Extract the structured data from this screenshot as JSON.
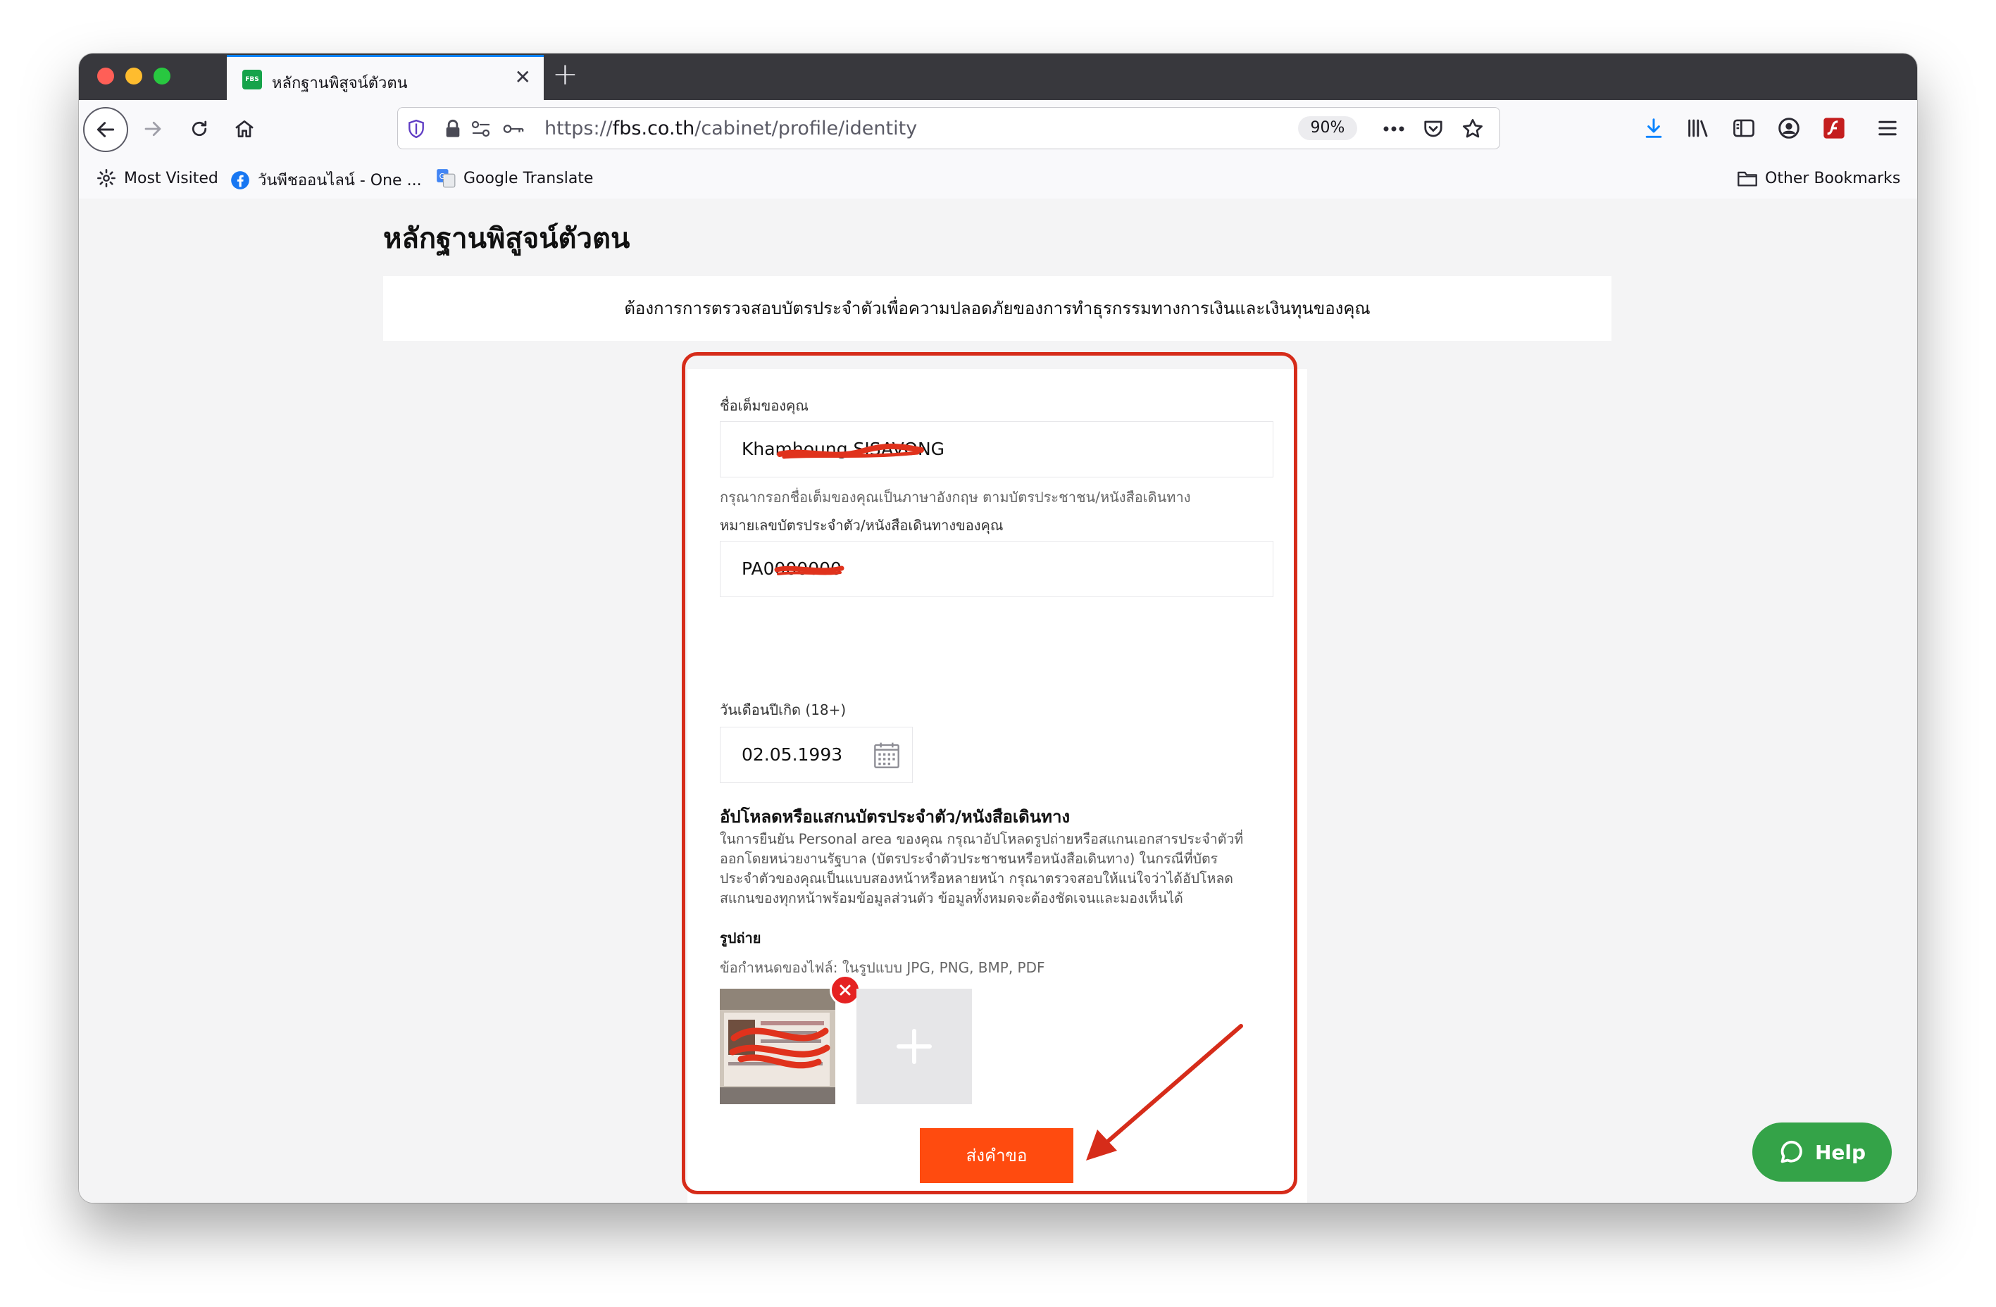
{
  "browser": {
    "tab": {
      "title": "หลักฐานพิสูจน์ตัวตน",
      "favicon_text": "FBS"
    },
    "url": {
      "scheme": "https://",
      "host": "fbs.co.th",
      "path": "/cabinet/profile/identity"
    },
    "zoom": "90%",
    "bookmarks": [
      {
        "label": "Most Visited",
        "icon": "gear-icon"
      },
      {
        "label": "วันพีชออนไลน์ - One ...",
        "icon": "facebook-icon"
      },
      {
        "label": "Google Translate",
        "icon": "google-translate-icon"
      }
    ],
    "other_bookmarks": "Other Bookmarks"
  },
  "page": {
    "title": "หลักฐานพิสูจน์ตัวตน",
    "banner": "ต้องการการตรวจสอบบัตรประจำตัวเพื่อความปลอดภัยของการทำธุรกรรมทางการเงินและเงินทุนของคุณ"
  },
  "form": {
    "fullname_label": "ชื่อเต็มของคุณ",
    "fullname_value": "Khamhoung SISAVONG",
    "fullname_hint": "กรุณากรอกชื่อเต็มของคุณเป็นภาษาอังกฤษ ตามบัตรประชาชน/หนังสือเดินทาง",
    "id_label": "หมายเลขบัตรประจำตัว/หนังสือเดินทางของคุณ",
    "id_value": "PA0000000",
    "dob_label": "วันเดือนปีเกิด (18+)",
    "dob_value": "02.05.1993",
    "upload_title": "อัปโหลดหรือแสกนบัตรประจำตัว/หนังสือเดินทาง",
    "upload_desc": [
      "ในการยืนยัน Personal area ของคุณ กรุณาอัปโหลดรูปถ่ายหรือสแกนเอกสารประจำตัวที่",
      "ออกโดยหน่วยงานรัฐบาล (บัตรประจำตัวประชาชนหรือหนังสือเดินทาง) ในกรณีที่บัตร",
      "ประจำตัวของคุณเป็นแบบสองหน้าหรือหลายหน้า กรุณาตรวจสอบให้แน่ใจว่าได้อัปโหลด",
      "สแกนของทุกหน้าพร้อมข้อมูลส่วนตัว ข้อมูลทั้งหมดจะต้องชัดเจนและมองเห็นได้"
    ],
    "photo_label": "รูปถ่าย",
    "file_rules": "ข้อกำหนดของไฟล์: ในรูปแบบ JPG, PNG, BMP, PDF",
    "submit_label": "ส่งคำขอ"
  },
  "help": {
    "label": "Help"
  },
  "colors": {
    "accent": "#ff4b0f",
    "annotation": "#d62c1a",
    "help_bg": "#34a348",
    "remove": "#e52222",
    "tab_indicator": "#0a84ff"
  }
}
